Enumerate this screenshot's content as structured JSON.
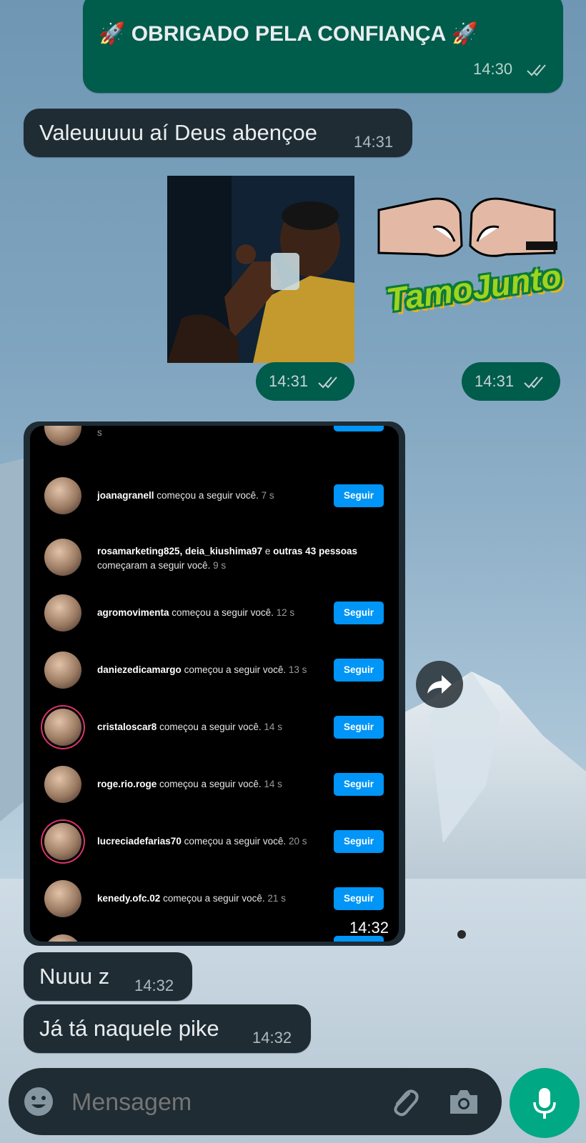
{
  "messages": {
    "m1": {
      "text": "🚀 OBRIGADO PELA CONFIANÇA 🚀",
      "time": "14:30"
    },
    "m2": {
      "text": "Valeuuuuu aí Deus abençoe",
      "time": "14:31"
    },
    "m3": {
      "time": "14:31"
    },
    "m4": {
      "sticker_text": "TamoJunto",
      "time": "14:31"
    },
    "m5": {
      "time": "14:32"
    },
    "m6": {
      "text": "Nuuu z",
      "time": "14:32"
    },
    "m7": {
      "text": "Já tá naquele pike",
      "time": "14:32"
    }
  },
  "instagram": {
    "button_label": "Seguir",
    "top_partial_text": "s",
    "rows": [
      {
        "user": "joanagranell",
        "action": "começou a seguir você.",
        "time": "7 s",
        "button": true
      },
      {
        "user": "rosamarketing825, deia_kiushima97",
        "mid": "e",
        "extra": "outras 43 pessoas",
        "action2": "começaram a seguir você.",
        "time": "9 s",
        "button": false
      },
      {
        "user": "agromovimenta",
        "action": "começou a seguir você.",
        "time": "12 s",
        "button": true
      },
      {
        "user": "daniezedicamargo",
        "action": "começou a seguir você.",
        "time": "13 s",
        "button": true
      },
      {
        "user": "cristaloscar8",
        "action": "começou a seguir você.",
        "time": "14 s",
        "button": true
      },
      {
        "user": "roge.rio.roge",
        "action": "começou a seguir você.",
        "time": "14 s",
        "button": true
      },
      {
        "user": "lucreciadefarias70",
        "action": "começou a seguir você.",
        "time": "20 s",
        "button": true
      },
      {
        "user": "kenedy.ofc.02",
        "action": "começou a seguir você.",
        "time": "21 s",
        "button": true
      }
    ]
  },
  "input": {
    "placeholder": "Mensagem"
  },
  "colors": {
    "outgoing": "#005c4b",
    "incoming": "#1f2c34",
    "accent": "#00a884",
    "ig_button": "#0095f6"
  },
  "icons": [
    "emoji-icon",
    "attach-icon",
    "camera-icon",
    "mic-icon",
    "forward-icon",
    "double-check-icon"
  ]
}
